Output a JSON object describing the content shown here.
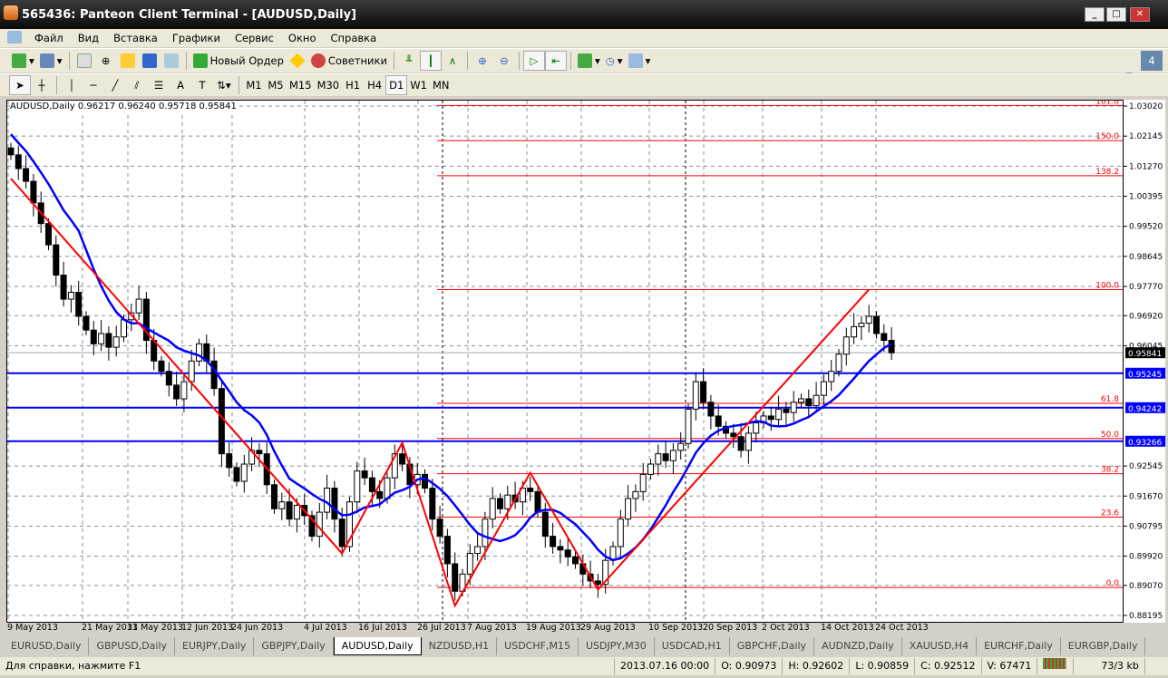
{
  "window": {
    "title": "565436: Panteon Client Terminal - [AUDUSD,Daily]",
    "minimize": "_",
    "maximize": "□",
    "close": "✕"
  },
  "menu": [
    "Файл",
    "Вид",
    "Вставка",
    "Графики",
    "Сервис",
    "Окно",
    "Справка"
  ],
  "toolbar": {
    "new_order": "Новый Ордер",
    "experts": "Советники"
  },
  "timeframes": [
    "M1",
    "M5",
    "M15",
    "M30",
    "H1",
    "H4",
    "D1",
    "W1",
    "MN"
  ],
  "active_timeframe": "D1",
  "chart": {
    "header": "AUDUSD,Daily  0.96217 0.96240 0.95718 0.95841",
    "bid": "0.95841",
    "price_ticks": [
      "1.03020",
      "1.02145",
      "1.01270",
      "1.00395",
      "0.99520",
      "0.98645",
      "0.97770",
      "0.96920",
      "0.96045",
      "0.92545",
      "0.91670",
      "0.90795",
      "0.89920",
      "0.89070",
      "0.88195"
    ],
    "horizontal_lines": [
      {
        "label": "0.95245",
        "value": 0.95245
      },
      {
        "label": "0.94242",
        "value": 0.94242
      },
      {
        "label": "0.93266",
        "value": 0.93266
      }
    ],
    "fibo": {
      "low": 0.8901,
      "high": 0.9768,
      "levels": [
        "0.0",
        "23.6",
        "38.2",
        "50.0",
        "61.8",
        "100.0",
        "138.2",
        "150.0",
        "161.8"
      ]
    },
    "time_labels": [
      "9 May 2013",
      "21 May 2013",
      "31 May 2013",
      "12 Jun 2013",
      "24 Jun 2013",
      "4 Jul 2013",
      "16 Jul 2013",
      "26 Jul 2013",
      "7 Aug 2013",
      "19 Aug 2013",
      "29 Aug 2013",
      "10 Sep 2013",
      "20 Sep 2013",
      "2 Oct 2013",
      "14 Oct 2013",
      "24 Oct 2013"
    ],
    "zigzag": [
      1.0091,
      0.9,
      0.9322,
      0.8848,
      0.9235,
      0.8895,
      0.9768
    ],
    "closes": [
      1.016,
      1.012,
      1.0083,
      1.002,
      0.996,
      0.9898,
      0.981,
      0.974,
      0.976,
      0.969,
      0.965,
      0.961,
      0.964,
      0.96,
      0.963,
      0.968,
      0.97,
      0.974,
      0.962,
      0.956,
      0.953,
      0.949,
      0.945,
      0.95,
      0.956,
      0.961,
      0.956,
      0.948,
      0.929,
      0.925,
      0.921,
      0.926,
      0.93,
      0.929,
      0.92,
      0.913,
      0.915,
      0.91,
      0.914,
      0.911,
      0.905,
      0.912,
      0.919,
      0.91,
      0.902,
      0.915,
      0.924,
      0.922,
      0.918,
      0.916,
      0.922,
      0.929,
      0.926,
      0.92,
      0.923,
      0.919,
      0.91,
      0.905,
      0.897,
      0.889,
      0.894,
      0.9,
      0.902,
      0.91,
      0.916,
      0.913,
      0.917,
      0.915,
      0.919,
      0.918,
      0.912,
      0.905,
      0.902,
      0.901,
      0.899,
      0.897,
      0.894,
      0.892,
      0.891,
      0.898,
      0.902,
      0.91,
      0.916,
      0.918,
      0.923,
      0.926,
      0.929,
      0.927,
      0.93,
      0.932,
      0.942,
      0.95,
      0.944,
      0.94,
      0.937,
      0.935,
      0.934,
      0.93,
      0.935,
      0.938,
      0.94,
      0.939,
      0.942,
      0.941,
      0.944,
      0.945,
      0.943,
      0.946,
      0.95,
      0.953,
      0.958,
      0.963,
      0.966,
      0.967,
      0.969,
      0.964,
      0.962,
      0.9584
    ],
    "colors": {
      "zigzag": "#ff0000",
      "ma": "#0000ff",
      "levels": "#0000ff",
      "fibo": "#ff0000"
    }
  },
  "tabs": [
    "EURUSD,Daily",
    "GBPUSD,Daily",
    "EURJPY,Daily",
    "GBPJPY,Daily",
    "AUDUSD,Daily",
    "NZDUSD,H1",
    "USDCHF,M15",
    "USDJPY,M30",
    "USDCAD,H1",
    "GBPCHF,Daily",
    "AUDNZD,Daily",
    "XAUUSD,H4",
    "EURCHF,Daily",
    "EURGBP,Daily"
  ],
  "active_tab": "AUDUSD,Daily",
  "status": {
    "help": "Для справки, нажмите F1",
    "time": "2013.07.16 00:00",
    "open": "O: 0.90973",
    "high": "H: 0.92602",
    "low": "L: 0.90859",
    "close": "C: 0.92512",
    "volume": "V: 67471",
    "traffic": "73/3 kb"
  }
}
